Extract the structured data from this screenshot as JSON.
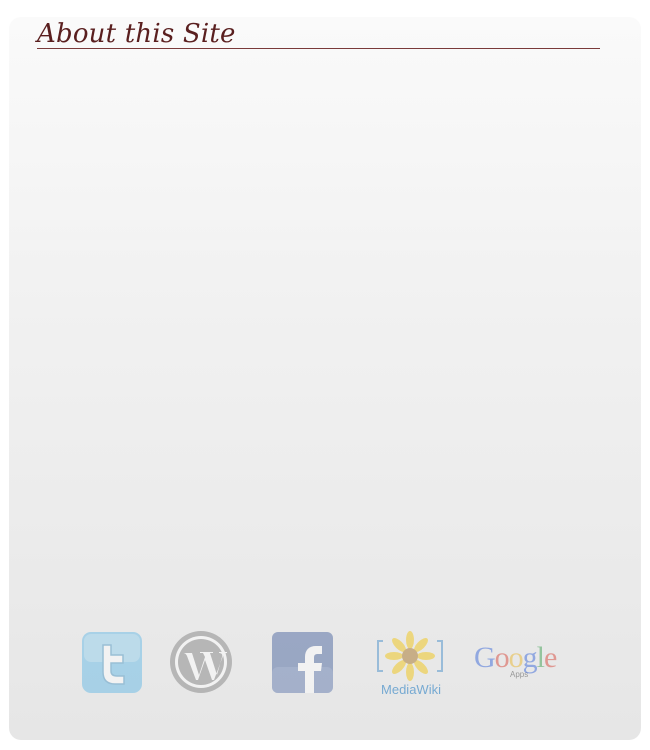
{
  "panel": {
    "title": "About this Site"
  },
  "logos": [
    {
      "name": "twitter-logo"
    },
    {
      "name": "wordpress-logo"
    },
    {
      "name": "facebook-logo"
    },
    {
      "name": "mediawiki-logo",
      "label": "MediaWiki"
    },
    {
      "name": "google-apps-logo",
      "label": "Google",
      "sublabel": "Apps"
    }
  ],
  "colors": {
    "title": "#5a1f1f",
    "rule": "#7a3a3a"
  }
}
